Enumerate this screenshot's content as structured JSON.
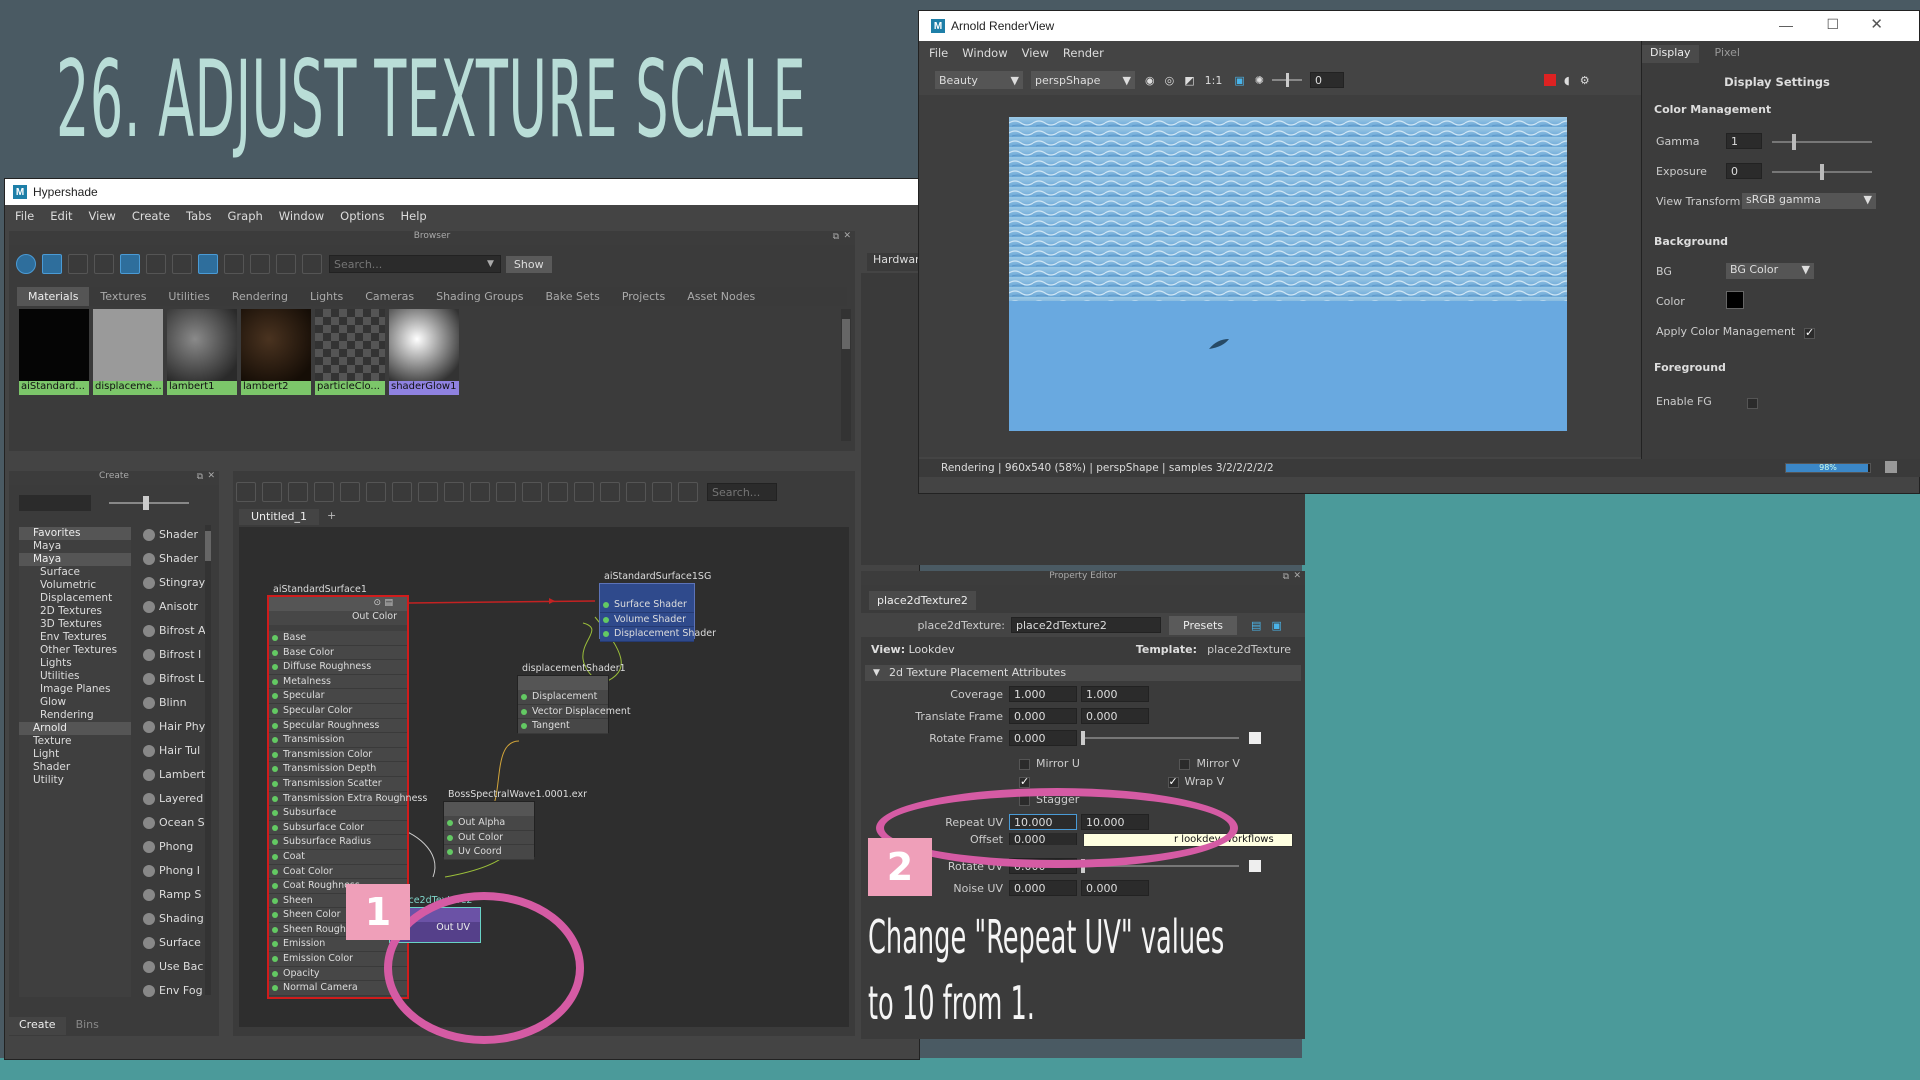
{
  "slide": {
    "title": "26. ADJUST TEXTURE SCALE",
    "badge1": "1",
    "badge2": "2",
    "instruction_line1": "Change \"Repeat UV\" values",
    "instruction_line2": "to 10 from 1."
  },
  "hypershade": {
    "title": "Hypershade",
    "menu": [
      "File",
      "Edit",
      "View",
      "Create",
      "Tabs",
      "Graph",
      "Window",
      "Options",
      "Help"
    ],
    "browser_label": "Browser",
    "search_placeholder": "Search...",
    "show_button": "Show",
    "browser_tabs": [
      "Materials",
      "Textures",
      "Utilities",
      "Rendering",
      "Lights",
      "Cameras",
      "Shading Groups",
      "Bake Sets",
      "Projects",
      "Asset Nodes"
    ],
    "materials": [
      "aiStandard...",
      "displaceme...",
      "lambert1",
      "lambert2",
      "particleClo...",
      "shaderGlow1"
    ],
    "create_label": "Create",
    "tree": [
      {
        "label": "Favorites",
        "hdr": true
      },
      {
        "label": "Maya",
        "indent": 2
      },
      {
        "label": "Maya",
        "hdr": true
      },
      {
        "label": "Surface",
        "indent": 3
      },
      {
        "label": "Volumetric",
        "indent": 3
      },
      {
        "label": "Displacement",
        "indent": 3
      },
      {
        "label": "2D Textures",
        "indent": 3
      },
      {
        "label": "3D Textures",
        "indent": 3
      },
      {
        "label": "Env Textures",
        "indent": 3
      },
      {
        "label": "Other Textures",
        "indent": 3
      },
      {
        "label": "Lights",
        "indent": 3
      },
      {
        "label": "Utilities",
        "indent": 3
      },
      {
        "label": "Image Planes",
        "indent": 3
      },
      {
        "label": "Glow",
        "indent": 3
      },
      {
        "label": "Rendering",
        "indent": 3
      },
      {
        "label": "Arnold",
        "hdr": true
      },
      {
        "label": "Texture",
        "indent": 2
      },
      {
        "label": "Light",
        "indent": 2
      },
      {
        "label": "Shader",
        "indent": 2
      },
      {
        "label": "Utility",
        "indent": 2
      }
    ],
    "create_list": [
      "Shader",
      "Shader",
      "Stingray",
      "Anisotr",
      "Bifrost A",
      "Bifrost I",
      "Bifrost L",
      "Blinn",
      "Hair Phy",
      "Hair Tul",
      "Lambert",
      "Layered",
      "Ocean S",
      "Phong",
      "Phong I",
      "Ramp S",
      "Shading",
      "Surface",
      "Use Bac",
      "Env Fog"
    ],
    "bottom_tabs": [
      "Create",
      "Bins"
    ],
    "graph_tab": "Untitled_1",
    "graph_tab_add": "+",
    "graph_search_placeholder": "Search...",
    "hardware_label": "Hardware",
    "nodes": {
      "surface_title": "aiStandardSurface1",
      "surface_out": "Out Color",
      "surface_attrs": [
        "Base",
        "Base Color",
        "Diffuse Roughness",
        "Metalness",
        "Specular",
        "Specular Color",
        "Specular Roughness",
        "Transmission",
        "Transmission Color",
        "Transmission Depth",
        "Transmission Scatter",
        "Transmission Extra Roughness",
        "Subsurface",
        "Subsurface Color",
        "Subsurface Radius",
        "Coat",
        "Coat Color",
        "Coat Roughness",
        "Sheen",
        "Sheen Color",
        "Sheen Roughness",
        "Emission",
        "Emission Color",
        "Opacity",
        "Normal Camera"
      ],
      "sg_title": "aiStandardSurface1SG",
      "sg_attrs": [
        "Surface Shader",
        "Volume Shader",
        "Displacement Shader"
      ],
      "disp_title": "displacementShader1",
      "disp_attrs": [
        "Displacement",
        "Vector Displacement",
        "Tangent"
      ],
      "file_title": "BossSpectralWave1.0001.exr",
      "file_attrs": [
        "Out Alpha",
        "Out Color",
        "Uv Coord"
      ],
      "place_title": "place2dTexture2",
      "place_out": "Out UV"
    }
  },
  "property_editor": {
    "header": "Property Editor",
    "tab": "place2dTexture2",
    "node_label": "place2dTexture:",
    "node_value": "place2dTexture2",
    "presets_button": "Presets",
    "view_label": "View:",
    "view_value": "Lookdev",
    "template_label": "Template:",
    "template_value": "place2dTexture",
    "section": "2d Texture Placement Attributes",
    "coverage": {
      "label": "Coverage",
      "u": "1.000",
      "v": "1.000"
    },
    "translate_frame": {
      "label": "Translate Frame",
      "u": "0.000",
      "v": "0.000"
    },
    "rotate_frame": {
      "label": "Rotate Frame",
      "value": "0.000"
    },
    "mirror_u": "Mirror U",
    "mirror_v": "Mirror V",
    "wrap_v": "Wrap V",
    "stagger": "Stagger",
    "repeat_uv": {
      "label": "Repeat UV",
      "u": "10.000",
      "v": "10.000"
    },
    "offset": {
      "label": "Offset",
      "u": "0.000"
    },
    "tooltip": "r lookdev workflows",
    "rotate_uv": {
      "label": "Rotate UV",
      "value": "0.000"
    },
    "noise_uv": {
      "label": "Noise UV",
      "u": "0.000",
      "v": "0.000"
    }
  },
  "renderview": {
    "title": "Arnold RenderView",
    "menu": [
      "File",
      "Window",
      "View",
      "Render"
    ],
    "aov": "Beauty",
    "camera": "perspShape",
    "ratio": "1:1",
    "exposure_box": "0",
    "status": "Rendering | 960x540 (58%) | perspShape | samples 3/2/2/2/2/2",
    "progress": "98%",
    "progress_value": 0.98,
    "side_tabs": [
      "Display",
      "Pixel"
    ],
    "display_settings": "Display Settings",
    "color_management": "Color Management",
    "gamma_label": "Gamma",
    "gamma_value": "1",
    "exposure_label": "Exposure",
    "exposure_value": "0",
    "view_transform_label": "View Transform",
    "view_transform_value": "sRGB gamma",
    "background": "Background",
    "bg_label": "BG",
    "bg_value": "BG Color",
    "color_label": "Color",
    "apply_cm": "Apply Color Management",
    "foreground": "Foreground",
    "enable_fg": "Enable FG"
  },
  "colors": {
    "slide_bg": "#4a5a63",
    "accent_teal": "#4b9a9a",
    "highlight_pink": "#d55ba4",
    "badge_pink": "#ef9fb9",
    "maya_panel": "#444444"
  }
}
